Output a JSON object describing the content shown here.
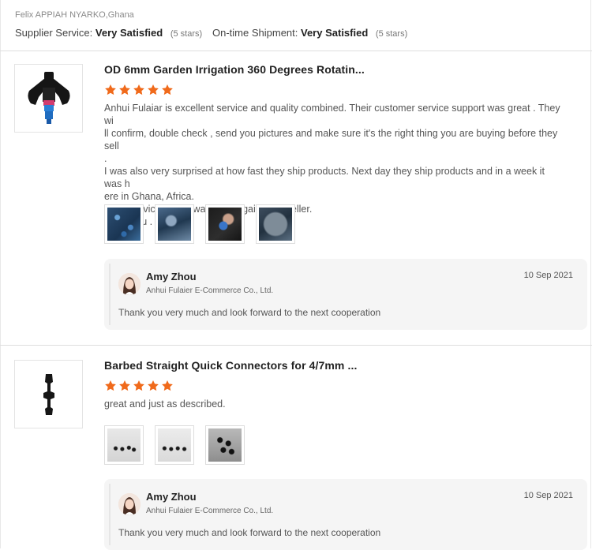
{
  "header": {
    "reviewer": "Felix APPIAH NYARKO,Ghana",
    "supplier_label": "Supplier Service:",
    "supplier_value": "Very Satisfied",
    "supplier_stars": "(5 stars)",
    "shipment_label": "On-time Shipment:",
    "shipment_value": "Very Satisfied",
    "shipment_stars": "(5 stars)"
  },
  "colors": {
    "star": "#f06a1b",
    "divider": "#dedede",
    "reply_bg": "#f5f5f5"
  },
  "reviews": [
    {
      "title": "OD 6mm Garden Irrigation 360 Degrees Rotatin...",
      "rating": 5,
      "body": [
        "Anhui Fulaiar is excellent service and quality combined. Their customer service support was great . They wi",
        "ll confirm, double check , send you pictures and make sure it's the right thing you are buying before they sell",
        ".",
        "I was also very surprised at how fast they ship products. Next day they ship products and in a week it was h",
        "ere in Ghana, Africa.",
        "great service I will always buy again from seller.",
        "thank you ."
      ],
      "photo_count": 4,
      "reply": {
        "name": "Amy Zhou",
        "company": "Anhui Fulaier E-Commerce Co., Ltd.",
        "date": "10 Sep 2021",
        "text": "Thank you very much and look forward to the next cooperation"
      }
    },
    {
      "title": "Barbed Straight Quick Connectors for 4/7mm ...",
      "rating": 5,
      "body": [
        "great and just as described."
      ],
      "photo_count": 3,
      "reply": {
        "name": "Amy Zhou",
        "company": "Anhui Fulaier E-Commerce Co., Ltd.",
        "date": "10 Sep 2021",
        "text": "Thank you very much and look forward to the next cooperation"
      }
    }
  ]
}
